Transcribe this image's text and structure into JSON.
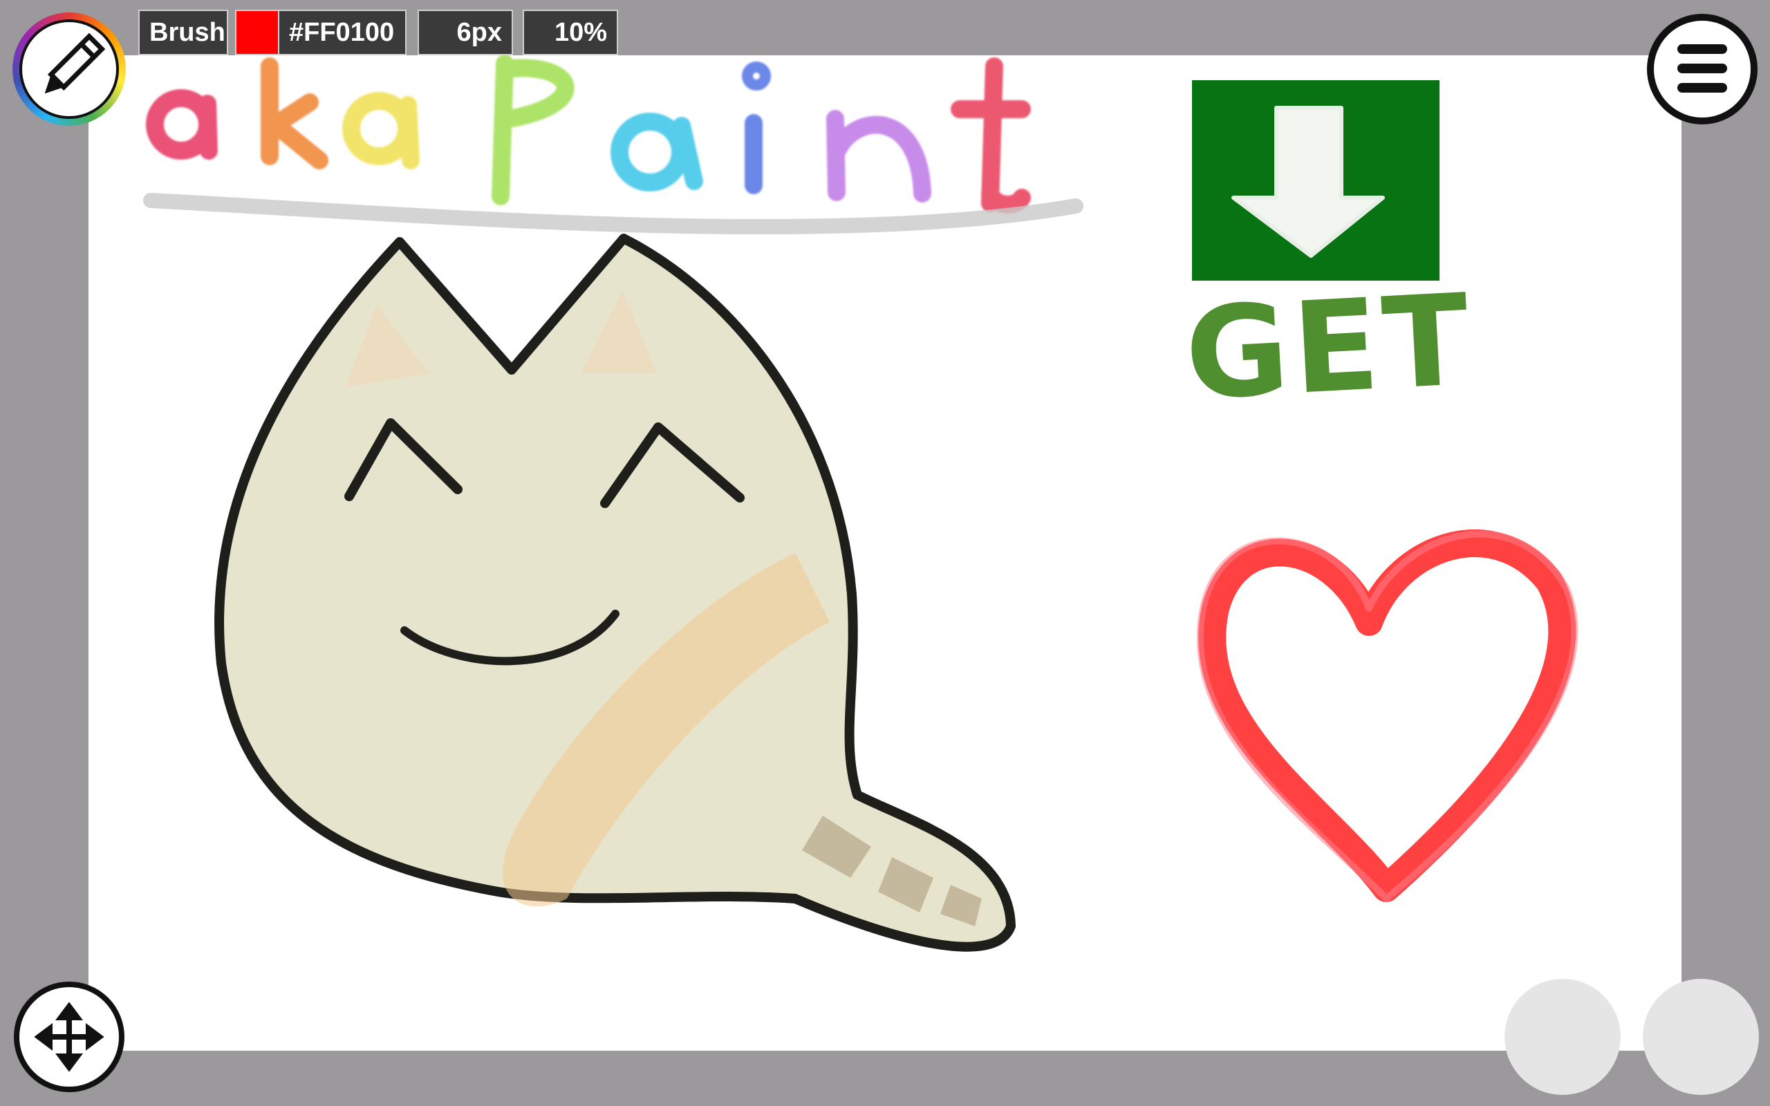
{
  "toolbar": {
    "tool_label": "Brush",
    "color_hex": "#FF0100",
    "brush_size": "6px",
    "opacity": "10%"
  },
  "colors": {
    "current_color": "#ff0100",
    "background": "#9b999c",
    "canvas": "#ffffff"
  },
  "drawing": {
    "title_text": "akaPaint",
    "get_text": "GET"
  },
  "icons": {
    "tool": "pencil-icon",
    "menu": "hamburger-menu-icon",
    "move": "move-arrows-icon"
  }
}
